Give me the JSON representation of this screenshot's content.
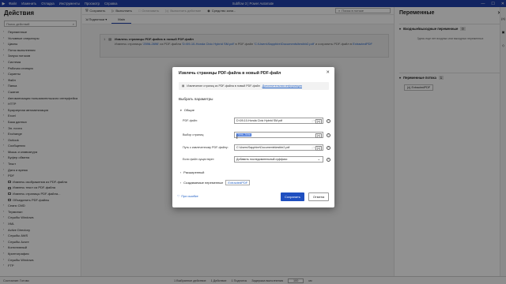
{
  "titlebar": {
    "menu": [
      "Файл",
      "Изменить",
      "Отладка",
      "Инструменты",
      "Просмотр",
      "Справка"
    ],
    "title": "Subflow 3 | Power Automate"
  },
  "left_panel": {
    "title": "Действия",
    "search_placeholder": "Поиск действий",
    "items": [
      "Переменные",
      "Условные операторы",
      "Циклы",
      "Поток выполнения",
      "Запуск потоков",
      "Система",
      "Рабочая станция",
      "Скрипты",
      "Файл",
      "Папка",
      "Сжатие",
      "Автоматизация пользовательского интерфейса",
      "HTTP",
      "Браузерная автоматизация",
      "Excel",
      "База данных",
      "Эл. почта",
      "Exchange",
      "Outlook",
      "Сообщения",
      "Мышь и клавиатура",
      "Буфер обмена",
      "Текст",
      "Дата и время",
      "PDF"
    ],
    "pdf_subitems": [
      "Извлечь изображения из PDF-файла",
      "Извлечь текст из PDF-файла",
      "Извлечь страницы PDF-файла...",
      "Объединить PDF-файлы"
    ],
    "items_after": [
      "Сеанс CMD",
      "Терминал",
      "Службы Windows",
      "XML",
      "Active Directory",
      "Службы AWS",
      "Службы Azure",
      "Когнитивный",
      "Криптография",
      "Службы Windows",
      "FTP"
    ]
  },
  "toolbar": {
    "save": "Сохранить",
    "run": "Выполнить",
    "stop": "Остановить",
    "next": "Выполнить действие",
    "recorder": "Средство запи...",
    "search_placeholder": "Поиск в потоке"
  },
  "subbar": {
    "subflows": "Подпотоки",
    "main_tab": "Main"
  },
  "flow_action": {
    "number": "1",
    "title": "Извлечь страницы PDF-файла в новый PDF-файл",
    "desc_prefix": "Извлечь страницы ",
    "desc_pages": "'2596-2696'",
    "desc_mid1": " из PDF-файла ",
    "desc_file": "'D:\\09-10-Honda Civic Hybrid SM.pdf'",
    "desc_mid2": " в PDF-файл ",
    "desc_target": "'C:\\Users\\Sapphire\\Documents\\testbir2.pdf'",
    "desc_mid3": " и сохранить PDF-файл в ",
    "desc_var": "ExtractedPDF"
  },
  "right_panel": {
    "title": "Переменные",
    "io_section": "Входные/выходные переменные",
    "io_count": "0",
    "io_empty": "Здесь еще нет входных или выходных переменных",
    "flow_section": "Переменные потока",
    "flow_count": "1",
    "flow_var": "ExtractedPDF"
  },
  "status_bar": {
    "state": "Состояние: Готово",
    "selected": "1 Выбранное действие",
    "actions": "1 Действие",
    "subflows": "1 Подпоток",
    "delay_label": "Задержка выполнения",
    "delay_value": "100",
    "unit": "мс"
  },
  "dialog": {
    "title": "Извлечь страницы PDF-файла в новый PDF-файл",
    "description": "Извлечение страниц из PDF-файла в новый PDF-файл",
    "more_info": "Дополнительная информация",
    "select_params": "Выбрать параметры",
    "general": "Общие",
    "fields": {
      "pdf_file_label": "PDF-файл:",
      "pdf_file_value": "D:\\09-10-Honda Civic Hybrid SM.pdf",
      "pages_label": "Выбор страниц:",
      "pages_value": "2596-2696",
      "path_label": "Путь к извлеченному PDF-файлу:",
      "path_value": "C:\\Users\\Sapphire\\Documents\\testbir2.pdf",
      "exists_label": "Если файл существует:",
      "exists_value": "Добавить последовательный суффикс"
    },
    "advanced": "Расширенный",
    "produced": "Создаваемые переменные",
    "produced_var": "ExtractedPDF",
    "on_error": "При ошибке",
    "save": "Сохранить",
    "cancel": "Отмена"
  }
}
